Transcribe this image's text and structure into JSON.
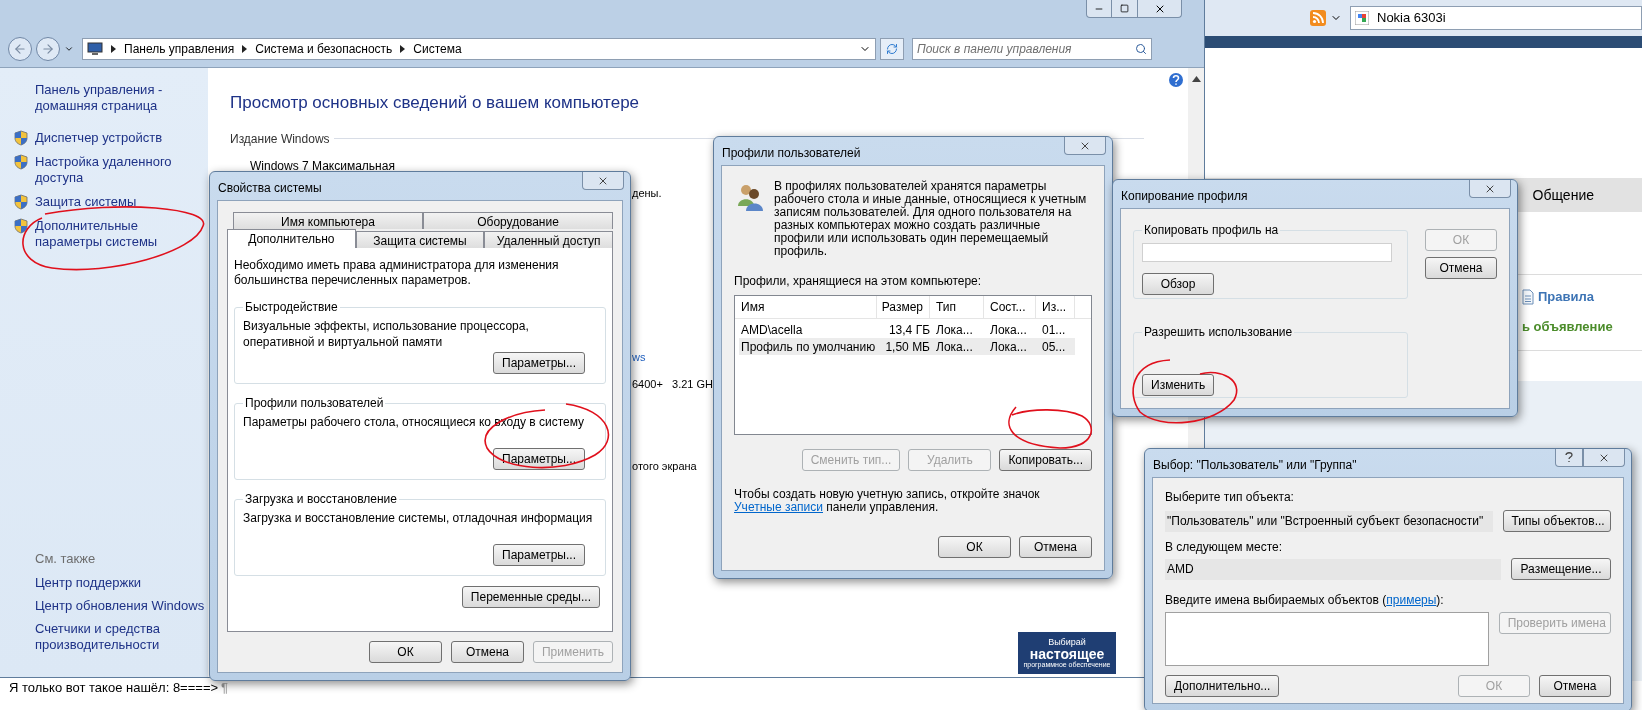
{
  "control_panel": {
    "breadcrumbs": [
      "Панель управления",
      "Система и безопасность",
      "Система"
    ],
    "search": {
      "placeholder": "Поиск в панели управления"
    },
    "sidebar": {
      "home_link": "Панель управления - домашняя страница",
      "items": [
        "Диспетчер устройств",
        "Настройка удаленного доступа",
        "Защита системы",
        "Дополнительные параметры системы"
      ],
      "see_also": {
        "title": "См. также",
        "links": [
          "Центр поддержки",
          "Центр обновления Windows",
          "Счетчики и средства производительности"
        ]
      }
    },
    "content": {
      "heading": "Просмотр основных сведений о вашем компьютере",
      "section": "Издание Windows",
      "edition": "Windows 7 Максимальная",
      "fragments": [
        {
          "text": "дены.",
          "kind": "plain"
        },
        {
          "text": "ws",
          "kind": "link"
        },
        {
          "text": "6400+   3.21 GH",
          "kind": "plain"
        },
        {
          "text": "отого экрана",
          "kind": "plain"
        }
      ]
    }
  },
  "browser": {
    "search_value": "Nokia 6303i",
    "tab": "Общение",
    "links": [
      {
        "text": "Правила",
        "color": "#3d74b5"
      },
      {
        "text": "ь объявление",
        "color": "#4b8c2a"
      }
    ]
  },
  "system_properties": {
    "title": "Свойства системы",
    "tab_rows": [
      [
        {
          "label": "Имя компьютера",
          "selected": false
        },
        {
          "label": "Оборудование",
          "selected": false
        }
      ],
      [
        {
          "label": "Дополнительно",
          "selected": true
        },
        {
          "label": "Защита системы",
          "selected": false
        },
        {
          "label": "Удаленный доступ",
          "selected": false
        }
      ]
    ],
    "notice": "Необходимо иметь права администратора для изменения большинства перечисленных параметров.",
    "groups": [
      {
        "title": "Быстродействие",
        "text": "Визуальные эффекты, использование процессора, оперативной и виртуальной памяти",
        "button": "Параметры..."
      },
      {
        "title": "Профили пользователей",
        "text": "Параметры рабочего стола, относящиеся ко входу в систему",
        "button": "Параметры..."
      },
      {
        "title": "Загрузка и восстановление",
        "text": "Загрузка и восстановление системы, отладочная информация",
        "button": "Параметры..."
      }
    ],
    "env_button": "Переменные среды...",
    "buttons": [
      {
        "label": "ОК",
        "disabled": false
      },
      {
        "label": "Отмена",
        "disabled": false
      },
      {
        "label": "Применить",
        "disabled": true
      }
    ]
  },
  "user_profiles": {
    "title": "Профили пользователей",
    "intro": "В профилях пользователей хранятся параметры рабочего стола и иные данные, относящиеся к учетным записям пользователей. Для одного пользователя на разных компьютерах можно создать различные профили или использовать один перемещаемый профиль.",
    "list_label": "Профили, хранящиеся на этом компьютере:",
    "columns": [
      "Имя",
      "Размер",
      "Тип",
      "Сост...",
      "Из..."
    ],
    "rows": [
      {
        "cells": [
          "AMD\\acella",
          "13,4 ГБ",
          "Лока...",
          "Лока...",
          "01..."
        ],
        "selected": false
      },
      {
        "cells": [
          "Профиль по умолчанию",
          "1,50 МБ",
          "Лока...",
          "Лока...",
          "05..."
        ],
        "selected": true
      }
    ],
    "actions": [
      {
        "label": "Сменить тип...",
        "disabled": true
      },
      {
        "label": "Удалить",
        "disabled": true
      },
      {
        "label": "Копировать...",
        "disabled": false
      }
    ],
    "footer": {
      "before": "Чтобы создать новую учетную запись, откройте значок ",
      "link": "Учетные записи",
      "after": " панели управления."
    },
    "buttons": [
      {
        "label": "ОК",
        "disabled": false
      },
      {
        "label": "Отмена",
        "disabled": false
      }
    ]
  },
  "copy_profile": {
    "title": "Копирование профиля",
    "target_group": "Копировать профиль на",
    "browse_button": "Обзор",
    "permission_group": "Разрешить использование",
    "change_button": "Изменить",
    "buttons": [
      {
        "label": "ОК",
        "disabled": true
      },
      {
        "label": "Отмена",
        "disabled": false
      }
    ]
  },
  "select_user": {
    "title": "Выбор: \"Пользователь\" или \"Группа\"",
    "type_label": "Выберите тип объекта:",
    "type_value": "\"Пользователь\" или \"Встроенный субъект безопасности\"",
    "types_button": "Типы объектов...",
    "location_label": "В следующем месте:",
    "location_value": "AMD",
    "location_button": "Размещение...",
    "names_label": {
      "before": "Введите имена выбираемых объектов (",
      "link": "примеры",
      "after": "):"
    },
    "check_button": {
      "label": "Проверить имена",
      "disabled": true
    },
    "advanced_button": "Дополнительно...",
    "buttons": [
      {
        "label": "ОК",
        "disabled": true
      },
      {
        "label": "Отмена",
        "disabled": false
      }
    ]
  },
  "banner": {
    "lines": [
      "Выбирай",
      "настоящее",
      "программное обеспечение"
    ]
  },
  "chat_message": {
    "text": "Я только вот такое нашёл: 8====>",
    "mark": "¶"
  }
}
